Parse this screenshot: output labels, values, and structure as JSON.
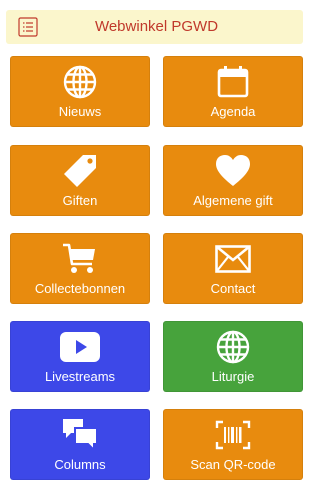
{
  "header": {
    "title": "Webwinkel PGWD",
    "menu_icon": "list-icon"
  },
  "colors": {
    "orange": "#e88b0e",
    "blue": "#3d48e8",
    "green": "#47a33c",
    "header_bg": "#fbf6cc",
    "title": "#c0392b"
  },
  "tiles": [
    {
      "label": "Nieuws",
      "icon": "globe-icon",
      "color": "orange"
    },
    {
      "label": "Agenda",
      "icon": "calendar-icon",
      "color": "orange"
    },
    {
      "label": "Giften",
      "icon": "tag-icon",
      "color": "orange"
    },
    {
      "label": "Algemene gift",
      "icon": "heart-icon",
      "color": "orange"
    },
    {
      "label": "Collectebonnen",
      "icon": "cart-icon",
      "color": "orange"
    },
    {
      "label": "Contact",
      "icon": "envelope-icon",
      "color": "orange"
    },
    {
      "label": "Livestreams",
      "icon": "play-icon",
      "color": "blue"
    },
    {
      "label": "Liturgie",
      "icon": "globe-icon",
      "color": "green"
    },
    {
      "label": "Columns",
      "icon": "chat-icon",
      "color": "blue"
    },
    {
      "label": "Scan QR-code",
      "icon": "barcode-icon",
      "color": "orange"
    }
  ]
}
